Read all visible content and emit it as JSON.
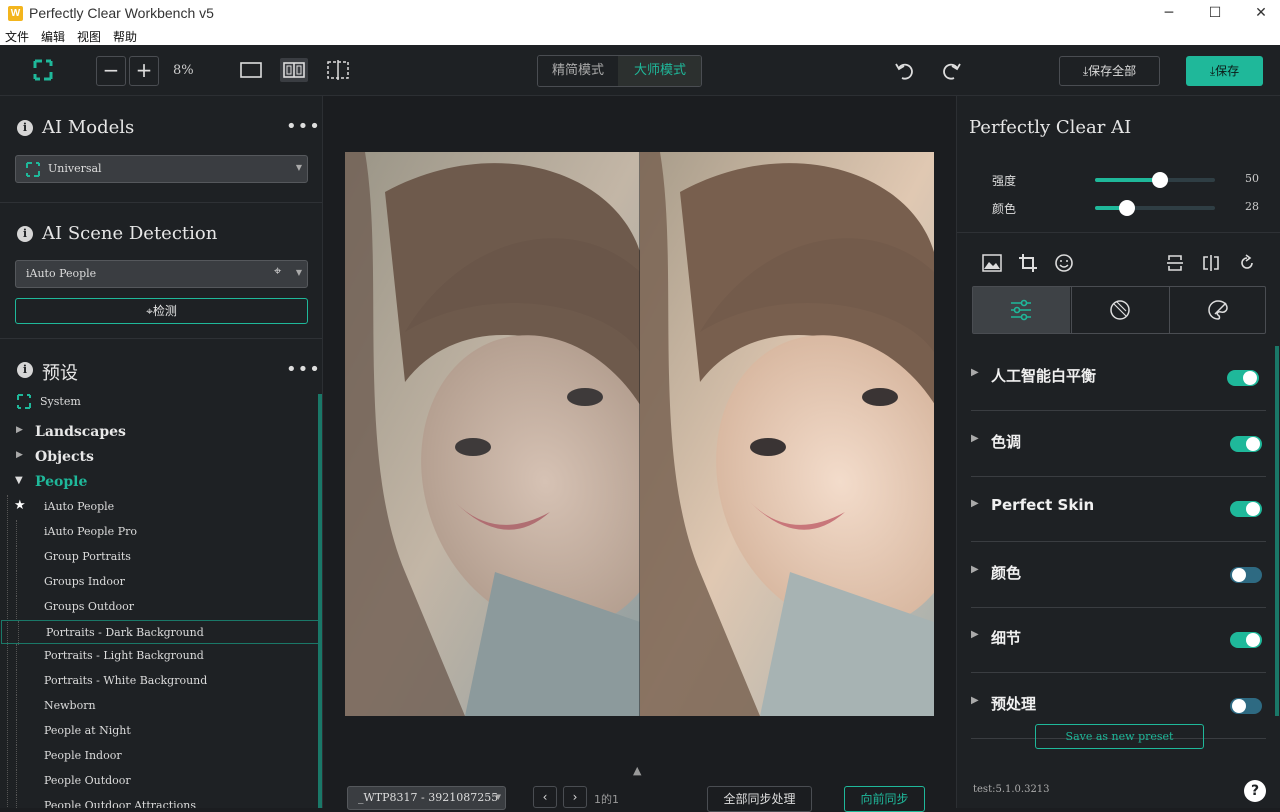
{
  "window": {
    "title": "Perfectly Clear Workbench v5",
    "minimize": "─",
    "maximize": "☐",
    "close": "✕"
  },
  "menu": [
    "文件",
    "编辑",
    "视图",
    "帮助"
  ],
  "toolbar": {
    "zoom": "8%",
    "mode_simple": "精简模式",
    "mode_master": "大师模式",
    "save_all": "保存全部",
    "save": "保存"
  },
  "left": {
    "ai_models": {
      "title": "AI Models",
      "selected": "Universal"
    },
    "scene": {
      "title": "AI Scene Detection",
      "selected": "iAuto People",
      "detect_label": "检测"
    },
    "presets": {
      "title": "预设",
      "system_label": "System",
      "categories": [
        "Landscapes",
        "Objects"
      ],
      "open_category": "People",
      "items": [
        "iAuto People",
        "iAuto People Pro",
        "Group Portraits",
        "Groups Indoor",
        "Groups Outdoor",
        "Portraits - Dark Background",
        "Portraits - Light Background",
        "Portraits - White Background",
        "Newborn",
        "People at Night",
        "People Indoor",
        "People Outdoor",
        "People Outdoor Attractions"
      ],
      "selected_index": 5,
      "starred_index": 0
    }
  },
  "center": {
    "filename": "_WTP8317 - 3921087255",
    "page_info": "1的1",
    "sync_all": "全部同步处理",
    "sync_forward": "向前同步"
  },
  "right": {
    "title": "Perfectly Clear AI",
    "sliders": [
      {
        "label": "强度",
        "value": "50",
        "fraction": 0.5
      },
      {
        "label": "颜色",
        "value": "28",
        "fraction": 0.28
      }
    ],
    "adjustments": [
      {
        "label": "人工智能白平衡",
        "on": true
      },
      {
        "label": "色调",
        "on": true
      },
      {
        "label": "Perfect Skin",
        "on": true
      },
      {
        "label": "颜色",
        "on": false
      },
      {
        "label": "细节",
        "on": true
      },
      {
        "label": "预处理",
        "on": false
      }
    ],
    "save_preset": "Save as new preset",
    "version": "test:5.1.0.3213",
    "help": "?"
  },
  "colors": {
    "accent": "#1fb89a",
    "accent_dark": "#17a086",
    "panel": "#1e2124",
    "toggle_off": "#2e6a82"
  }
}
